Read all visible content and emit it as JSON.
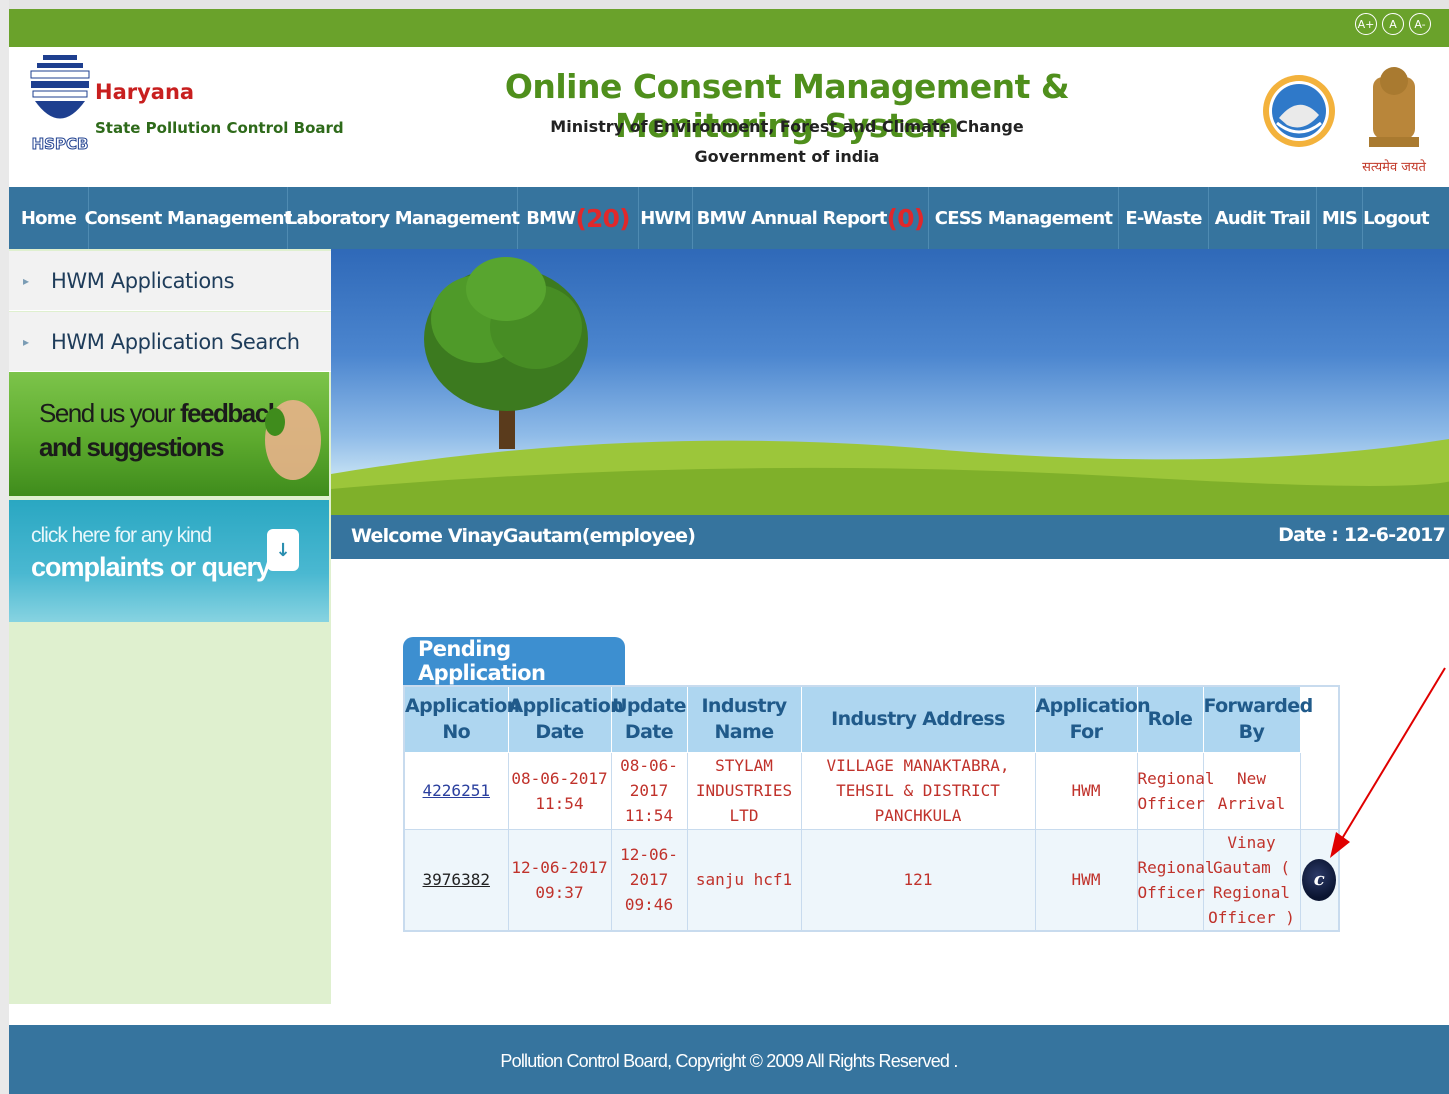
{
  "font_controls": [
    "A+",
    "A",
    "A-"
  ],
  "header": {
    "logo_text": "HSPCB",
    "org_name": "Haryana",
    "org_sub": "State Pollution Control Board",
    "title": "Online Consent Management & Monitoring System",
    "ministry": "Ministry of Environment, Forest and Climate Change",
    "government": "Government of india",
    "emblem_caption": "सत्यमेव जयते"
  },
  "nav": [
    {
      "label": "Home",
      "badge": ""
    },
    {
      "label": "Consent Management",
      "badge": ""
    },
    {
      "label": "Laboratory Management",
      "badge": ""
    },
    {
      "label": "BMW",
      "badge": "(20)"
    },
    {
      "label": "HWM",
      "badge": ""
    },
    {
      "label": "BMW Annual Report",
      "badge": "(0)"
    },
    {
      "label": "CESS Management",
      "badge": ""
    },
    {
      "label": "E-Waste",
      "badge": ""
    },
    {
      "label": "Audit Trail",
      "badge": ""
    },
    {
      "label": "MIS",
      "badge": ""
    },
    {
      "label": "Logout",
      "badge": ""
    }
  ],
  "sidebar": {
    "items": [
      {
        "label": "HWM Applications"
      },
      {
        "label": "HWM Application Search"
      }
    ],
    "feedback": {
      "line1_a": "Send us your",
      "line1_b": "feedback",
      "line2": "and suggestions"
    },
    "complaints": {
      "line1": "click here for any kind",
      "line2": "complaints or query"
    }
  },
  "welcome": {
    "text": "Welcome VinayGautam(employee)",
    "date": "Date : 12-6-2017"
  },
  "pending": {
    "tab_label": "Pending Application",
    "columns": [
      "Application No",
      "Application Date",
      "Update Date",
      "Industry Name",
      "Industry Address",
      "Application For",
      "Role",
      "Forwarded By"
    ],
    "rows": [
      {
        "app_no": "4226251",
        "app_date": "08-06-2017 11:54",
        "update_date": "08-06- 2017 11:54",
        "industry_name": "STYLAM INDUSTRIES LTD",
        "industry_address": "VILLAGE MANAKTABRA, TEHSIL & DISTRICT PANCHKULA",
        "app_for": "HWM",
        "role": "Regional Officer",
        "forwarded_by": "New Arrival",
        "action": ""
      },
      {
        "app_no": "3976382",
        "app_date": "12-06-2017 09:37",
        "update_date": "12-06- 2017 09:46",
        "industry_name": "sanju hcf1",
        "industry_address": "121",
        "app_for": "HWM",
        "role": "Regional Officer",
        "forwarded_by": "Vinay Gautam ( Regional Officer )",
        "action": "c"
      }
    ]
  },
  "footer": {
    "text": "Pollution Control Board, Copyright © 2009 All Rights Reserved ."
  },
  "colors": {
    "topbar": "#6aa22b",
    "nav": "#36749e",
    "title_green": "#4f8f1c",
    "badge_red": "#e0282b",
    "table_header": "#aed6f0",
    "annotation_arrow": "#e00000"
  }
}
